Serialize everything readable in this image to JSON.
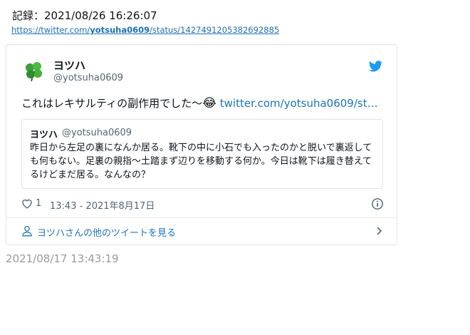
{
  "record": {
    "label": "記録：2021/08/26 16:26:07",
    "url_prefix": "https://twitter.com/",
    "url_user": "yotsuha0609",
    "url_suffix": "/status/1427491205382692885"
  },
  "tweet": {
    "display_name": "ヨツハ",
    "handle": "@yotsuha0609",
    "text": "これはレキサルティの副作用でした〜",
    "emoji": "😂",
    "link_text": "twitter.com/yotsuha0609/st…",
    "icons": {
      "avatar": "clover-avatar",
      "brand": "twitter-bird-icon",
      "like": "heart-icon",
      "info": "info-icon",
      "person": "person-icon",
      "chevron": "chevron-right-icon"
    },
    "colors": {
      "link": "#1d73b9",
      "twitter_blue": "#1d9bf0"
    },
    "quote": {
      "display_name": "ヨツハ",
      "handle": "@yotsuha0609",
      "text": "昨日から左足の裏になんか居る。靴下の中に小石でも入ったのかと脱いで裏返しても何もない。足裏の親指〜土踏まず辺りを移動する何か。今日は靴下は履き替えてるけどまだ居る。なんなの？"
    },
    "likes": "1",
    "timestamp": "13:43 - 2021年8月17日",
    "more_tweets_label": "ヨツハさんの他のツイートを見る"
  },
  "saved_time": "2021/08/17 13:43:19"
}
